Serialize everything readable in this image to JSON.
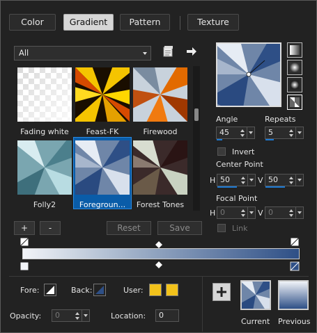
{
  "tabs": [
    {
      "label": "Color",
      "active": false
    },
    {
      "label": "Gradient",
      "active": true
    },
    {
      "label": "Pattern",
      "active": false
    },
    {
      "label": "Texture",
      "active": false
    }
  ],
  "category_select": {
    "value": "All"
  },
  "gradients": [
    {
      "label": "Fading white"
    },
    {
      "label": "Feast-FK"
    },
    {
      "label": "Firewood"
    },
    {
      "label": "Folly2"
    },
    {
      "label": "Foregroun...",
      "selected": true
    },
    {
      "label": "Forest Tones"
    }
  ],
  "buttons": {
    "add": "+",
    "remove": "-",
    "reset": "Reset",
    "save": "Save"
  },
  "angle": {
    "label": "Angle",
    "value": "45"
  },
  "repeats": {
    "label": "Repeats",
    "value": "5"
  },
  "invert": {
    "label": "Invert",
    "checked": false
  },
  "center_point": {
    "label": "Center Point",
    "h_label": "H",
    "h": "50",
    "v_label": "V",
    "v": "50"
  },
  "focal_point": {
    "label": "Focal Point",
    "h_label": "H",
    "h": "0",
    "v_label": "V",
    "v": "0"
  },
  "link": {
    "label": "Link",
    "checked": false
  },
  "fore": {
    "label": "Fore:"
  },
  "back": {
    "label": "Back:"
  },
  "user": {
    "label": "User:",
    "colors": [
      "#f2c21b",
      "#f2c21b"
    ]
  },
  "opacity": {
    "label": "Opacity:",
    "value": "0"
  },
  "location": {
    "label": "Location:",
    "value": "0"
  },
  "current_label": "Current",
  "previous_label": "Previous",
  "colors": {
    "accent": "#1d7ad4",
    "gradient_dark": "#2e4f86",
    "gradient_light": "#f2f4f8"
  }
}
